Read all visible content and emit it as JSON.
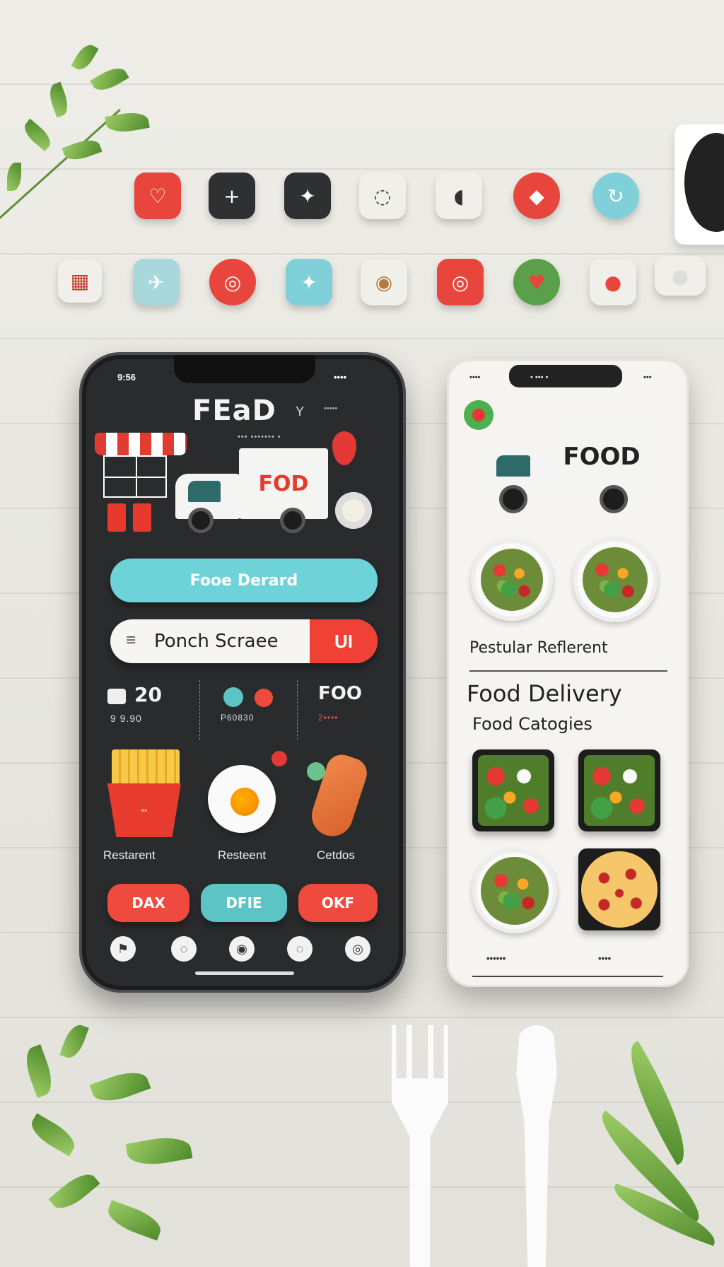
{
  "icon_row_1": [
    {
      "icon": "heart-icon",
      "color": "#e8453c",
      "glyph": "♡"
    },
    {
      "icon": "plus-icon",
      "color": "#2e3032",
      "glyph": "+"
    },
    {
      "icon": "star-icon",
      "color": "#2e3032",
      "glyph": "✦"
    },
    {
      "icon": "chat-icon",
      "color": "#f1efe9",
      "glyph": "◌"
    },
    {
      "icon": "leaf-icon",
      "color": "#f1efe9",
      "glyph": "◖"
    },
    {
      "icon": "diamond-icon",
      "color": "#e8453c",
      "glyph": "◆"
    },
    {
      "icon": "refresh-icon",
      "color": "#7fd0d8",
      "glyph": "↻"
    }
  ],
  "icon_row_2": [
    {
      "icon": "grid-icon",
      "color": "#f1efe9",
      "glyph": "▦"
    },
    {
      "icon": "plane-icon",
      "color": "#a8d7dc",
      "glyph": "✈"
    },
    {
      "icon": "target-icon",
      "color": "#e8453c",
      "glyph": "◎"
    },
    {
      "icon": "tag-icon",
      "color": "#7fd0d8",
      "glyph": "✦"
    },
    {
      "icon": "donut-icon",
      "color": "#f1efe9",
      "glyph": "◉"
    },
    {
      "icon": "swirl-icon",
      "color": "#e8453c",
      "glyph": "◎"
    },
    {
      "icon": "apple-icon",
      "color": "#5aa04a",
      "glyph": "♥"
    },
    {
      "icon": "tomato-icon",
      "color": "#f1efe9",
      "glyph": "●"
    },
    {
      "icon": "toggle-icon",
      "color": "#f1efe9",
      "glyph": "●"
    }
  ],
  "left_phone": {
    "status_left": "9:56",
    "status_right": "••••",
    "title": "FEaD",
    "title_suffix": "Y",
    "header_tag": "•••••",
    "subtitle": "••• ••••••• •",
    "truck_label": "FOD",
    "primary_button": "Fooe Derard",
    "search_value": "Ponch Scraee",
    "search_go": "UI",
    "stats": [
      {
        "value": "20",
        "sub": "9  9.90"
      },
      {
        "value": "● ●",
        "sub": "P60830"
      },
      {
        "value": "FOO",
        "sub": "2••••"
      }
    ],
    "fries_tag": "••",
    "food_labels": [
      "Restarent",
      "Resteent",
      "Cetdos"
    ],
    "buttons": [
      {
        "label": "DAX",
        "color": "#ef4a3e"
      },
      {
        "label": "DFIE",
        "color": "#5cc4c4"
      },
      {
        "label": "OKF",
        "color": "#ef4a3e"
      }
    ],
    "nav": [
      {
        "icon": "nav-home-icon",
        "glyph": "⚑"
      },
      {
        "icon": "nav-search-icon",
        "glyph": "◌"
      },
      {
        "icon": "nav-orders-icon",
        "glyph": "◉"
      },
      {
        "icon": "nav-cart-icon",
        "glyph": "◌"
      },
      {
        "icon": "nav-profile-icon",
        "glyph": "◎"
      }
    ]
  },
  "right_phone": {
    "status_left": "••••",
    "status_center": "• ••• •",
    "status_right": "•••",
    "truck_label": "FOOD",
    "section_title": "Pestular Reflerent",
    "heading": "Food Delivery",
    "subheading": "Food   Catogies",
    "bottom_left": "••••••",
    "bottom_right": "••••"
  }
}
